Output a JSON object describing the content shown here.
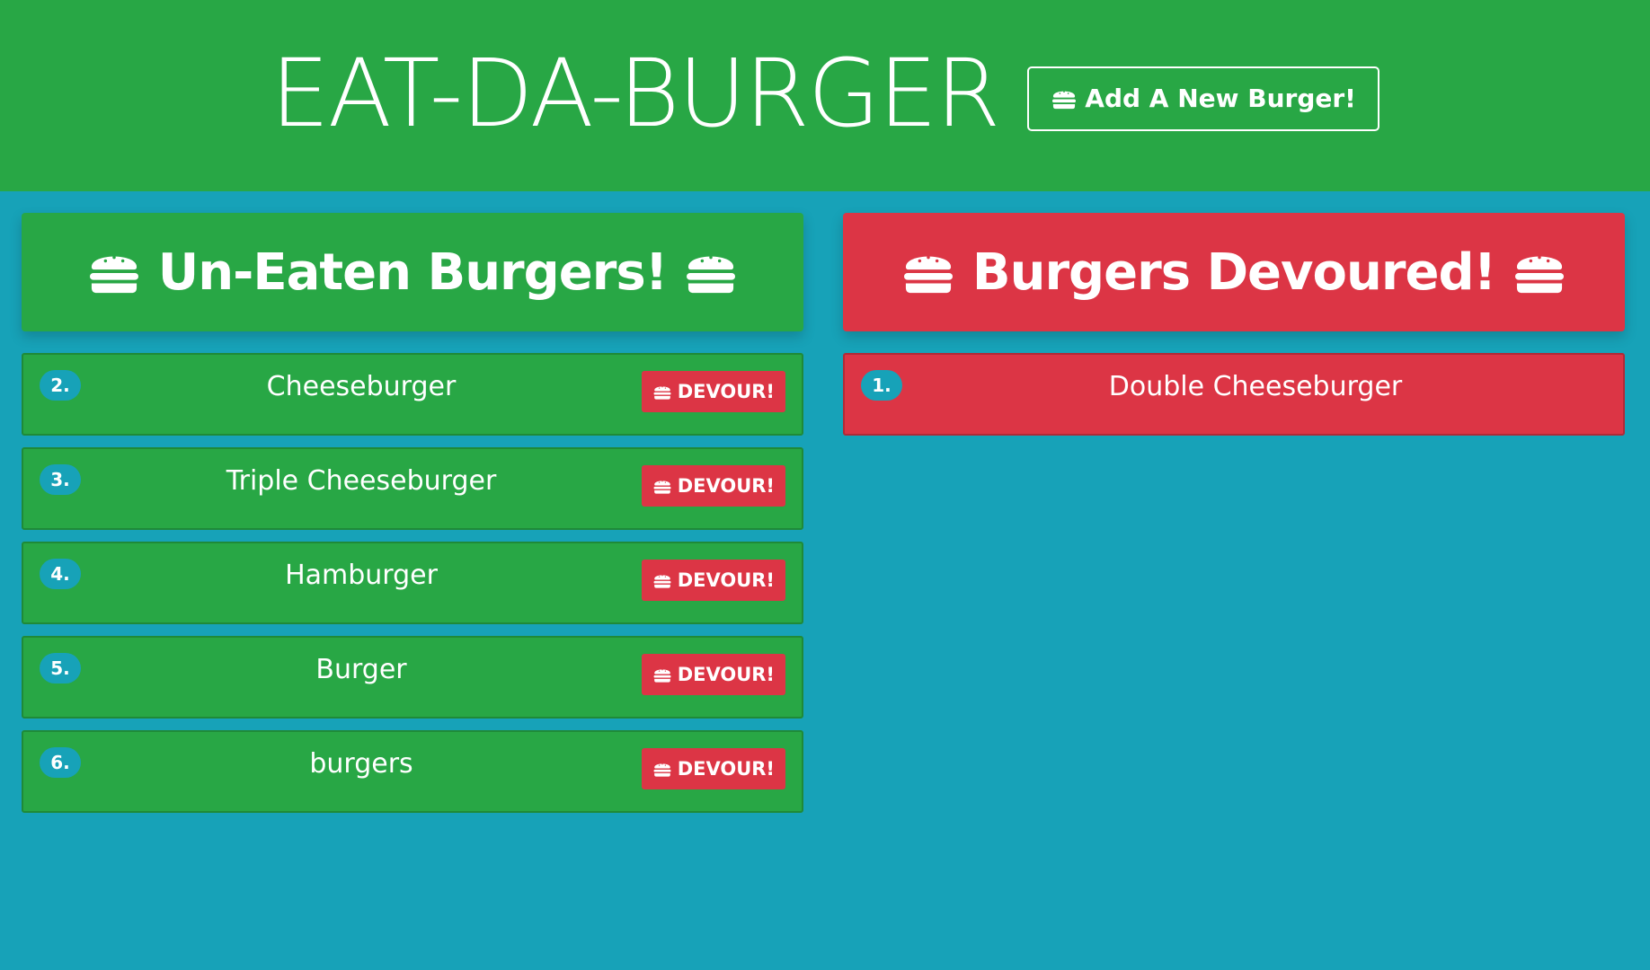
{
  "header": {
    "title": "EAT-DA-BURGER",
    "add_button_label": "Add A New Burger!",
    "add_button_icon": "hamburger-icon"
  },
  "uneaten": {
    "title": "Un-Eaten Burgers!",
    "icon": "hamburger-icon",
    "items": [
      {
        "number": "2.",
        "name": "Cheeseburger",
        "button_label": "DEVOUR!"
      },
      {
        "number": "3.",
        "name": "Triple Cheeseburger",
        "button_label": "DEVOUR!"
      },
      {
        "number": "4.",
        "name": "Hamburger",
        "button_label": "DEVOUR!"
      },
      {
        "number": "5.",
        "name": "Burger",
        "button_label": "DEVOUR!"
      },
      {
        "number": "6.",
        "name": "burgers",
        "button_label": "DEVOUR!"
      }
    ]
  },
  "devoured": {
    "title": "Burgers Devoured!",
    "icon": "hamburger-icon",
    "items": [
      {
        "number": "1.",
        "name": "Double Cheeseburger"
      }
    ]
  },
  "colors": {
    "background": "#17a2b8",
    "green": "#28a745",
    "red": "#dc3545",
    "badge": "#17a2b8"
  }
}
